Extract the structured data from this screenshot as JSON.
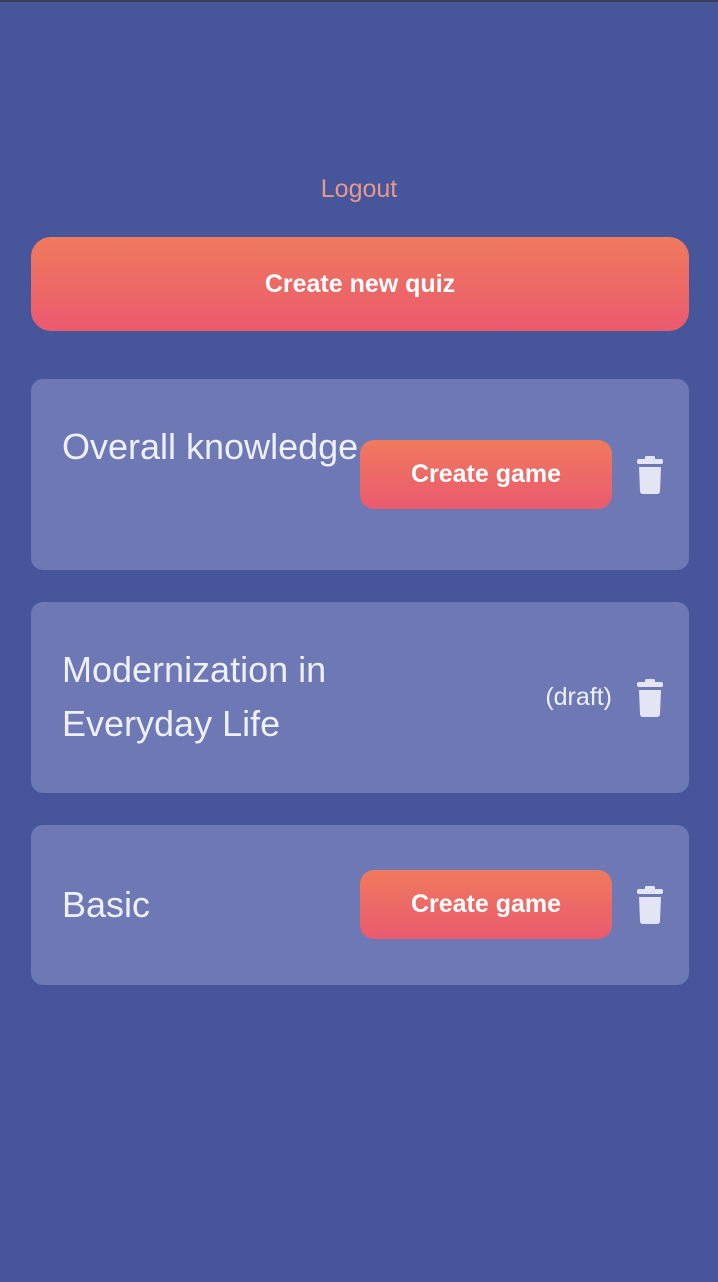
{
  "header": {
    "logout_label": "Logout"
  },
  "actions": {
    "create_quiz_label": "Create new quiz"
  },
  "quizzes": [
    {
      "title": "Overall knowledge",
      "status": "",
      "action_label": "Create game"
    },
    {
      "title": "Modernization in Everyday Life",
      "status": "(draft)",
      "action_label": ""
    },
    {
      "title": "Basic",
      "status": "",
      "action_label": "Create game"
    }
  ],
  "icons": {
    "delete": "trash-icon"
  },
  "colors": {
    "background": "#47569a",
    "card": "#6d78b4",
    "accent_top": "#ef7a5d",
    "accent_bottom": "#ea5a6f",
    "logout_text": "#e79a8c",
    "card_text": "#eef0fb",
    "icon": "#e3e5f4"
  }
}
